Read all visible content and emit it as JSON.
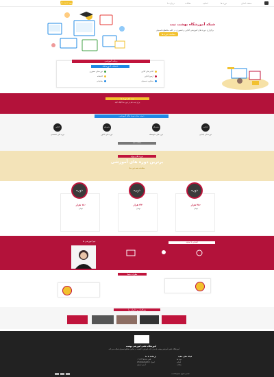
{
  "nav": {
    "items": [
      "صفحه اصلی",
      "دوره ها",
      "اساتید",
      "مقالات",
      "درباره ما"
    ],
    "cta": "ورود / ثبت نام"
  },
  "hero": {
    "title": "شبکه آموزشگاه بهشت نیت",
    "subtitle": "برگزاری دوره های آموزشی آنلاین و حضوری در کلیه مقاطع تحصیلی",
    "cta": "مشاهده دوره ها"
  },
  "features": {
    "ribbon": "برنامه آموزشی",
    "heading": "امکانات آموزشگاه",
    "items": [
      "کلاس های آنلاین",
      "آزمون آنلاین",
      "مشاوره تحصیلی",
      "دوره های حضوری",
      "کتابخانه",
      "پشتیبانی"
    ]
  },
  "red_band1": {
    "ribbon": "ثبت نام دوره ها",
    "text": "برای ثبت نام در دوره ها کلیک کنید"
  },
  "categories": {
    "ribbon": "دسته بندی دوره های آموزشی",
    "items": [
      "ابتدایی",
      "متوسطه اول",
      "متوسطه دوم",
      "کنکور"
    ],
    "labels": [
      "دوره های ابتدایی",
      "دوره های متوسطه",
      "دوره های کنکور",
      "دوره های تخصصی"
    ],
    "more": "مشاهده همه"
  },
  "courses": {
    "ribbon": "دوره های ویژه",
    "title": "برترین دوره های آموزشی",
    "cta": "مشاهده همه دوره ها",
    "cards": [
      {
        "label": "دوره",
        "price": "۲۵۰ هزار",
        "sub": "تومان"
      },
      {
        "label": "دوره",
        "price": "۳۲۰ هزار",
        "sub": "تومان"
      },
      {
        "label": "دوره",
        "price": "۱۸۰ هزار",
        "sub": "تومان"
      }
    ]
  },
  "teachers": {
    "title": "تیم آموزشی ما",
    "subtitle": "آشنایی با اساتید"
  },
  "reviews": {
    "ribbon": "نظرات شما"
  },
  "partners": {
    "ribbon": "همکاران و حامیان ما"
  },
  "footer": {
    "brand": "آموزشگاه علمی آموزشی بهشت",
    "about": "آموزشگاه علمی آموزشی بهشت با هدف ارائه آموزش با کیفیت در تمامی مقاطع تحصیلی فعالیت می کند.",
    "contact_head": "ارتباط با ما",
    "links_head": "لینک های مفید",
    "contact": [
      "تلفن: ۰۲۱۱۲۳۴۵۶۷۸",
      "ایمیل: info@behesht.ir",
      "آدرس: تهران"
    ],
    "links": [
      "دوره ها",
      "اساتید",
      "مقالات"
    ],
    "copyright": "تمامی حقوق محفوظ است"
  },
  "colors": {
    "accent": "#c0143c",
    "yellow": "#f2c12e",
    "blue": "#1e88e5",
    "dark": "#222222"
  }
}
